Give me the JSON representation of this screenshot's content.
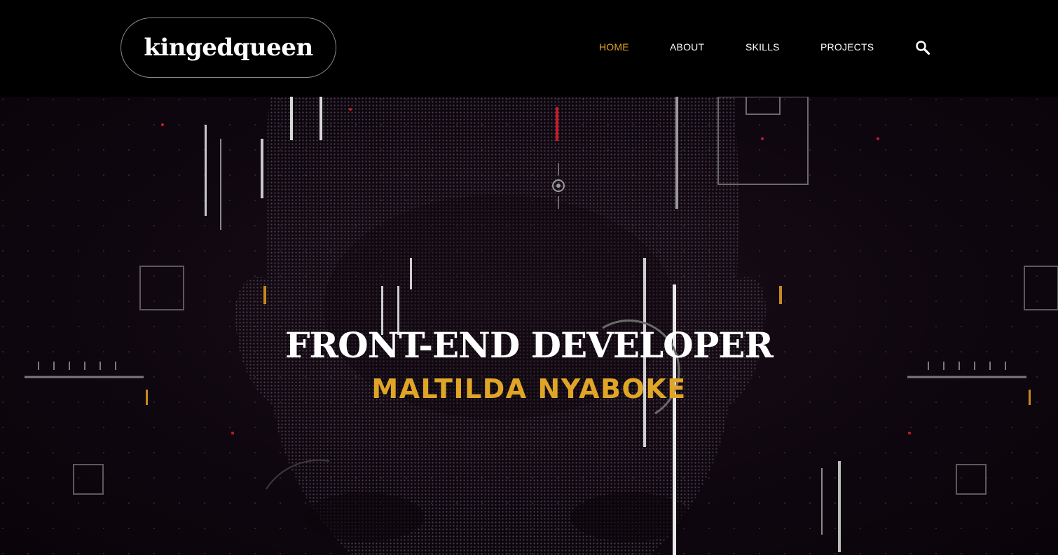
{
  "header": {
    "logo_text": "kingedqueen",
    "nav": [
      {
        "label": "HOME",
        "active": true
      },
      {
        "label": "ABOUT",
        "active": false
      },
      {
        "label": "SKILLS",
        "active": false
      },
      {
        "label": "PROJECTS",
        "active": false
      }
    ],
    "search_icon": "search-icon"
  },
  "hero": {
    "title": "FRONT-END DEVELOPER",
    "subtitle": "MALTILDA NYABOKE",
    "background": "digital-face-hud-image"
  },
  "colors": {
    "accent": "#e0a526",
    "background": "#000000",
    "text": "#ffffff"
  }
}
